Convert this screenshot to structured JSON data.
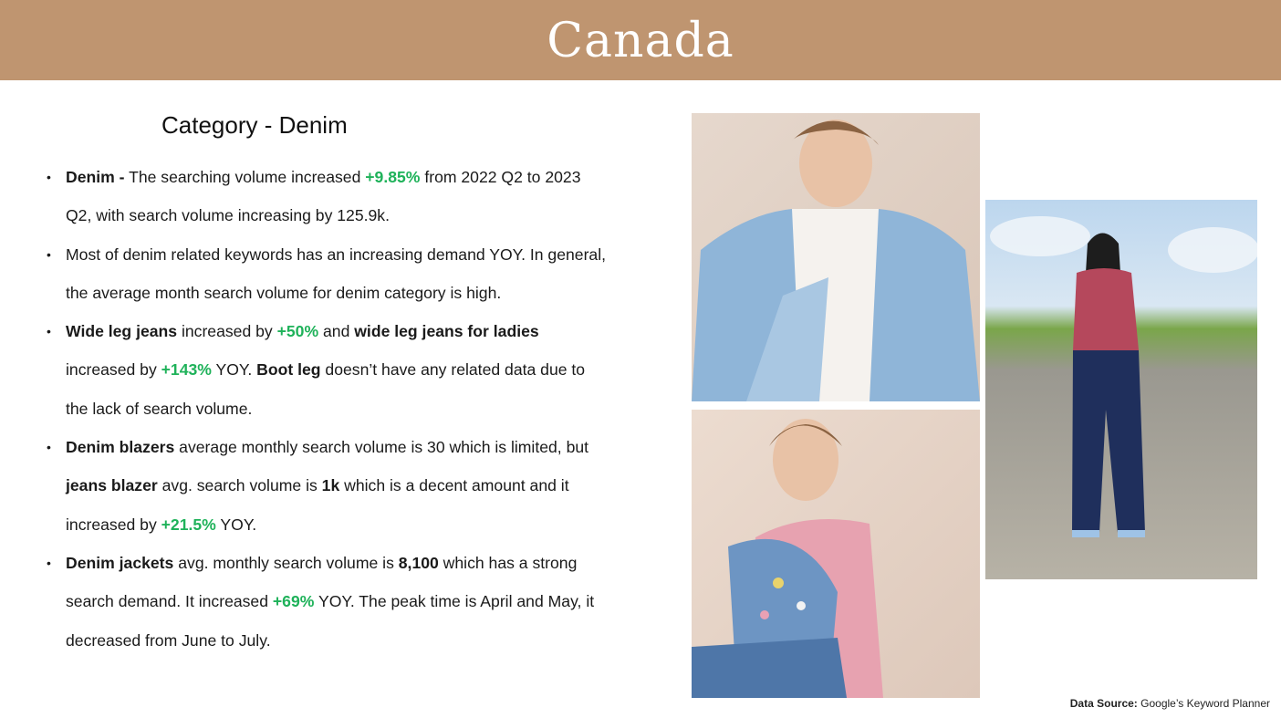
{
  "header": {
    "title": "Canada"
  },
  "section_title": "Category - Denim",
  "bullets": [
    {
      "parts": [
        {
          "t": "Denim -",
          "s": "b"
        },
        {
          "t": " The searching volume increased ",
          "s": ""
        },
        {
          "t": "+9.85%",
          "s": "g"
        },
        {
          "t": " from 2022 Q2 to 2023 Q2, with search volume increasing by 125.9k.",
          "s": ""
        }
      ]
    },
    {
      "parts": [
        {
          "t": "Most of denim related keywords has an increasing demand YOY. In general, the average month search volume for denim category is high.",
          "s": ""
        }
      ]
    },
    {
      "parts": [
        {
          "t": "Wide leg jeans",
          "s": "b"
        },
        {
          "t": " increased by ",
          "s": ""
        },
        {
          "t": "+50%",
          "s": "g"
        },
        {
          "t": " and ",
          "s": ""
        },
        {
          "t": "wide leg jeans for ladies",
          "s": "b"
        },
        {
          "t": " increased by ",
          "s": ""
        },
        {
          "t": "+143%",
          "s": "g"
        },
        {
          "t": " YOY. ",
          "s": ""
        },
        {
          "t": "Boot leg",
          "s": "b"
        },
        {
          "t": " doesn’t have any related data due to the lack of search volume.",
          "s": ""
        }
      ]
    },
    {
      "parts": [
        {
          "t": "Denim blazers",
          "s": "b"
        },
        {
          "t": " average monthly search volume is 30 which is limited, but ",
          "s": ""
        },
        {
          "t": "jeans blazer",
          "s": "b"
        },
        {
          "t": " avg. search volume is ",
          "s": ""
        },
        {
          "t": "1k",
          "s": "b"
        },
        {
          "t": " which is a decent amount and it increased by ",
          "s": ""
        },
        {
          "t": "+21.5%",
          "s": "g"
        },
        {
          "t": " YOY.",
          "s": ""
        }
      ]
    },
    {
      "parts": [
        {
          "t": "Denim jackets",
          "s": "b"
        },
        {
          "t": " avg. monthly search volume is ",
          "s": ""
        },
        {
          "t": "8,100",
          "s": "b"
        },
        {
          "t": " which has a strong search demand. It increased ",
          "s": ""
        },
        {
          "t": "+69%",
          "s": "g"
        },
        {
          "t": " YOY. The peak time is April and May, it decreased from June to July.",
          "s": ""
        }
      ]
    }
  ],
  "footer": {
    "source_label": "Data Source:",
    "source_value": " Google’s Keyword Planner"
  },
  "colors": {
    "header_bg": "#bf9570",
    "highlight_green": "#1fb25a"
  }
}
